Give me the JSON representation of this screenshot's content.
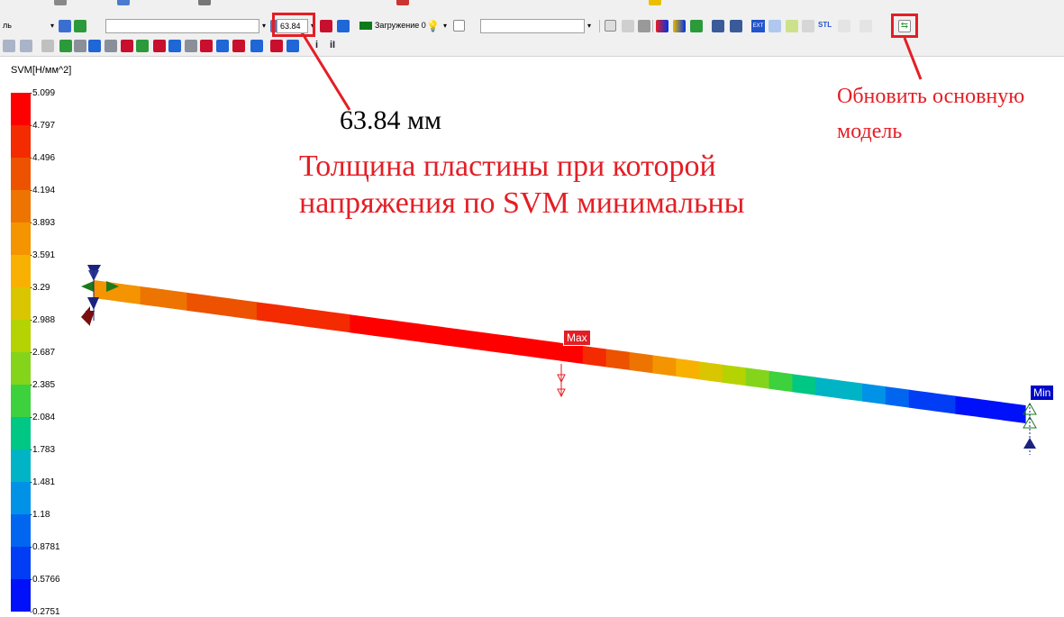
{
  "toolbar": {
    "row1": {
      "left_text": "ль",
      "thickness_value": "63.84",
      "load_case_label": "Загружение 0",
      "load_case_color": "#0f7a1c",
      "highlight_color": "#e41e25",
      "stl_label": "STL",
      "ext_label": "EXT"
    },
    "row2": {
      "info_label": "i",
      "info2_label": "iI"
    }
  },
  "legend": {
    "title": "SVM[Н/мм^2]",
    "ticks": [
      "5.099",
      "4.797",
      "4.496",
      "4.194",
      "3.893",
      "3.591",
      "3.29",
      "2.988",
      "2.687",
      "2.385",
      "2.084",
      "1.783",
      "1.481",
      "1.18",
      "0.8781",
      "0.5766",
      "0.2751"
    ],
    "colors": [
      "#ff0000",
      "#f42a00",
      "#ec5200",
      "#ed7400",
      "#f39400",
      "#f8b100",
      "#d9c600",
      "#b4d300",
      "#84d41c",
      "#3dd13d",
      "#00c783",
      "#00b4c5",
      "#0092e6",
      "#0066f0",
      "#003df5",
      "#0010f8"
    ]
  },
  "model": {
    "max_label": "Max",
    "min_label": "Min",
    "max_color": "#e41e25",
    "min_color": "#0008c8"
  },
  "annotations": {
    "value": "63.84 мм",
    "caption_line1": "Толщина пластины при которой",
    "caption_line2": "напряжения по SVM минимальны",
    "update_line1": "Обновить основную",
    "update_line2": "модель"
  }
}
